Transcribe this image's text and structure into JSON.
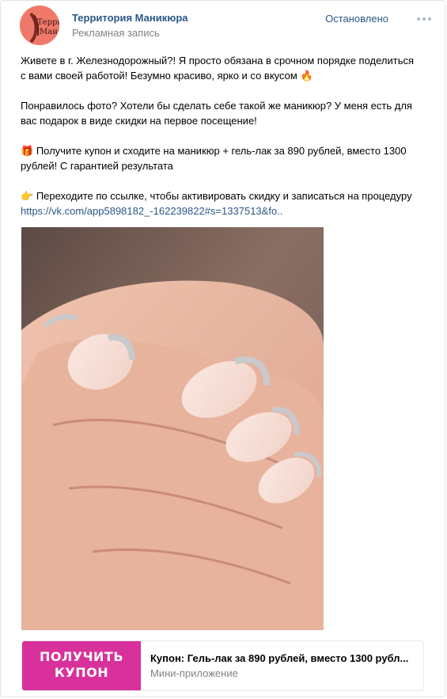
{
  "post": {
    "group_name": "Территория Маникюра",
    "ad_label": "Рекламная запись",
    "status": "Остановлено",
    "avatar_text": [
      "Терри",
      "Мани"
    ],
    "paragraphs": {
      "p1_line1": "Живете в г. Железнодорожный?! Я просто обязана в срочном порядке поделиться",
      "p1_line2": "с вами своей работой! Безумно красиво, ярко и со вкусом",
      "p1_emoji": "🔥",
      "p2_line1": "Понравилось фото? Хотели бы сделать себе такой же маникюр? У меня есть для",
      "p2_line2": "вас подарок в виде скидки на первое посещение!",
      "p3_emoji": "🎁",
      "p3_line1": "Получите купон и сходите на маникюр + гель-лак за 890 рублей, вместо 1300",
      "p3_line2": "рублей! С гарантией результата",
      "p4_emoji": "👉",
      "p4_line1": "Переходите по ссылке, чтобы активировать скидку и записаться на процедуру",
      "link": "https://vk.com/app5898182_-162239822#s=1337513&fo.."
    }
  },
  "snippet": {
    "button_line1": "ПОЛУЧИТЬ",
    "button_line2": "КУПОН",
    "title": "Купон: Гель-лак за 890 рублей, вместо 1300 рубл...",
    "subtitle": "Мини-приложение"
  },
  "icons": {
    "more": "more-horizontal-icon",
    "fire": "fire-emoji",
    "gift": "gift-emoji",
    "pointer": "pointing-right-emoji"
  },
  "colors": {
    "link": "#2a5885",
    "secondary": "#828282",
    "coupon_button": "#d8319b",
    "avatar_bg": "#f07a6a"
  }
}
